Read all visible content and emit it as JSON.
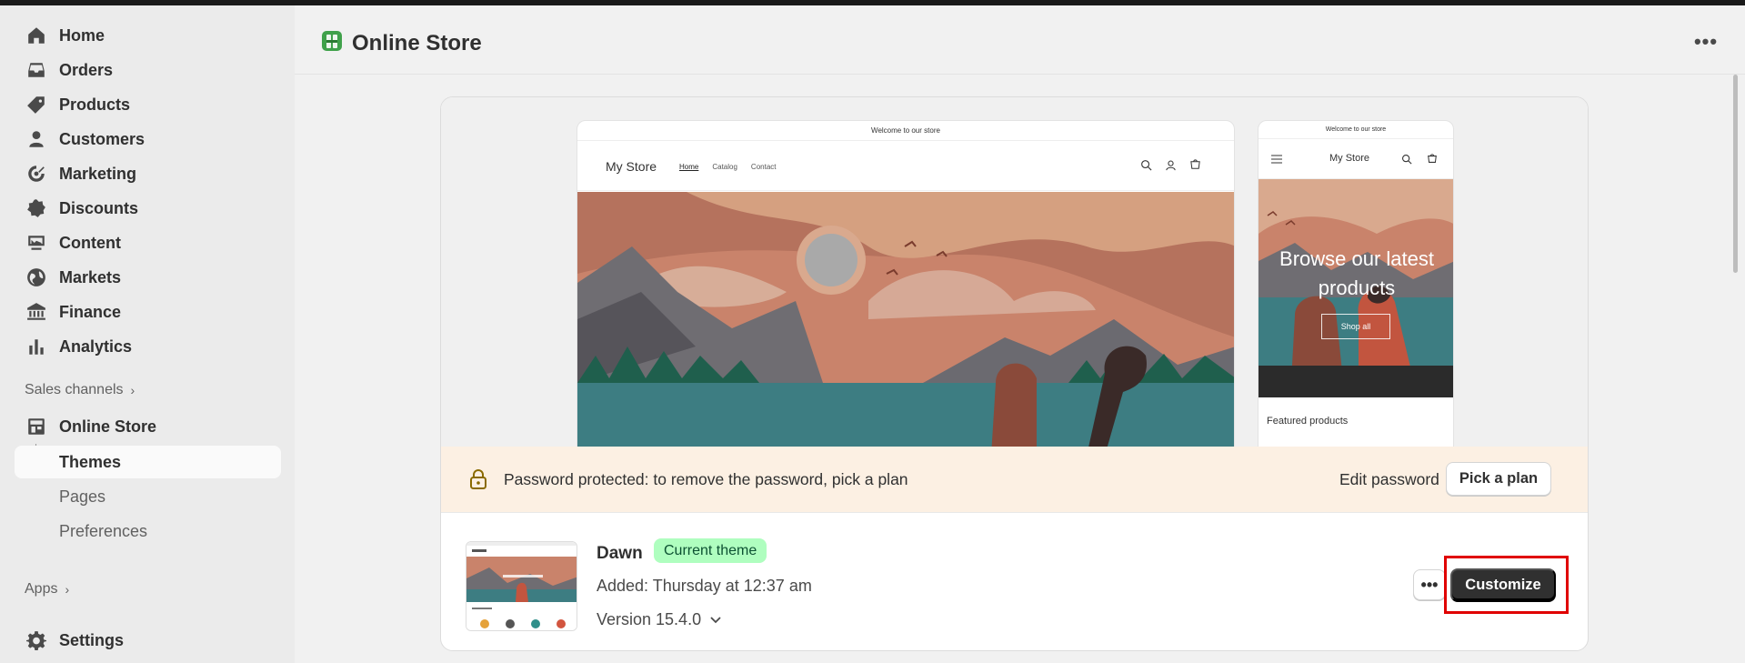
{
  "sidebar": {
    "items": [
      {
        "label": "Home",
        "icon": "home-icon"
      },
      {
        "label": "Orders",
        "icon": "inbox-icon"
      },
      {
        "label": "Products",
        "icon": "tag-icon"
      },
      {
        "label": "Customers",
        "icon": "person-icon"
      },
      {
        "label": "Marketing",
        "icon": "target-icon"
      },
      {
        "label": "Discounts",
        "icon": "discount-icon"
      },
      {
        "label": "Content",
        "icon": "content-icon"
      },
      {
        "label": "Markets",
        "icon": "globe-icon"
      },
      {
        "label": "Finance",
        "icon": "bank-icon"
      },
      {
        "label": "Analytics",
        "icon": "bar-chart-icon"
      }
    ],
    "sales_channels_label": "Sales channels",
    "online_store": {
      "label": "Online Store",
      "icon": "store-icon"
    },
    "sub_items": [
      "Themes",
      "Pages",
      "Preferences"
    ],
    "apps_label": "Apps",
    "settings": {
      "label": "Settings",
      "icon": "gear-icon"
    }
  },
  "header": {
    "title": "Online Store",
    "more_label": "•••"
  },
  "preview": {
    "desktop": {
      "announcement": "Welcome to our store",
      "logo": "My Store",
      "nav": [
        "Home",
        "Catalog",
        "Contact"
      ]
    },
    "mobile": {
      "announcement": "Welcome to our store",
      "logo": "My Store",
      "hero_line1": "Browse our latest",
      "hero_line2": "products",
      "shop_all": "Shop all",
      "featured": "Featured products"
    }
  },
  "banner": {
    "text": "Password protected: to remove the password, pick a plan",
    "edit_password": "Edit password",
    "pick_plan": "Pick a plan"
  },
  "theme": {
    "name": "Dawn",
    "badge": "Current theme",
    "added": "Added: Thursday at 12:37 am",
    "version": "Version 15.4.0",
    "more_label": "•••",
    "customize": "Customize"
  },
  "colors": {
    "badge_bg": "#affebf",
    "banner_bg": "#fcf0e3",
    "highlight": "#e00000",
    "primary_button": "#303030"
  }
}
